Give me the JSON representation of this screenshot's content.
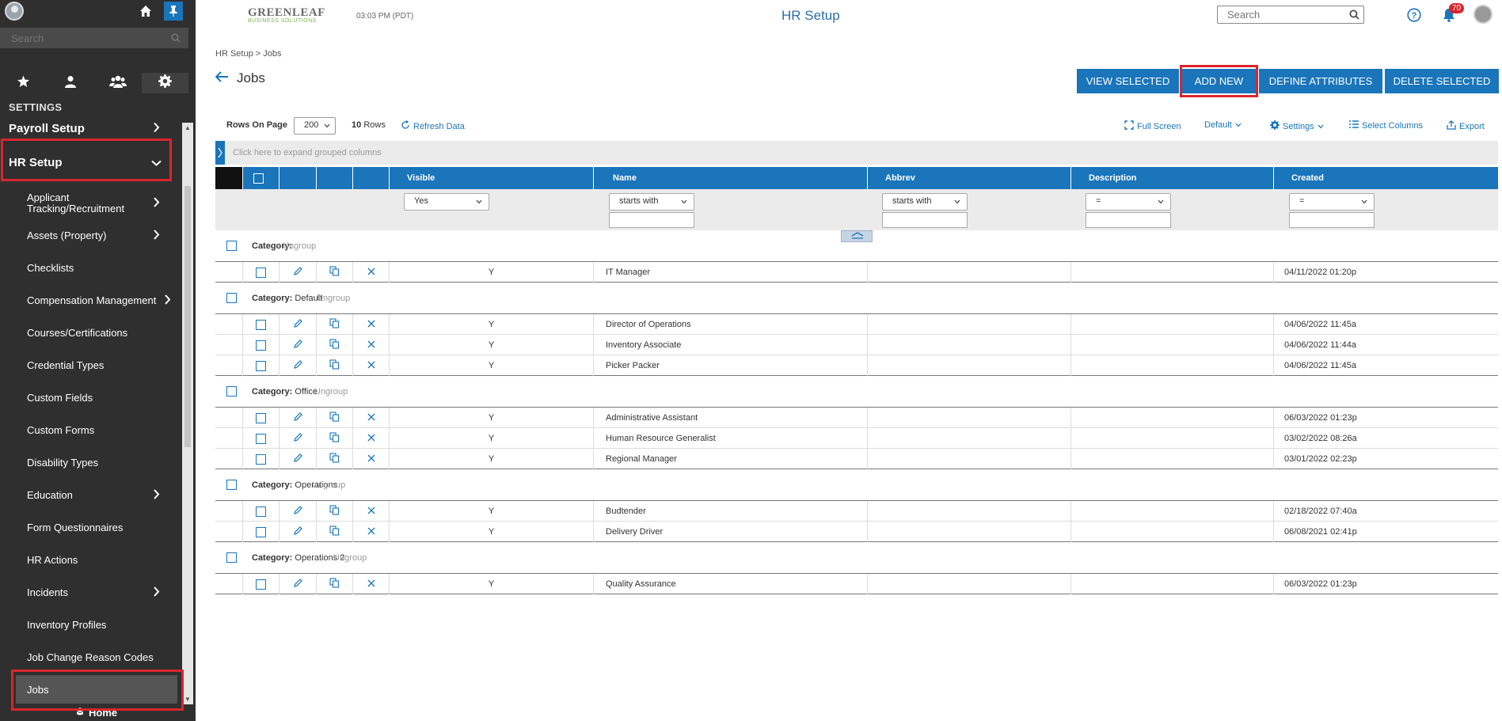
{
  "sidebar": {
    "search_placeholder": "Search",
    "settings_label": "SETTINGS",
    "items": [
      {
        "label": "Payroll Setup",
        "level": 1
      },
      {
        "label": "HR Setup",
        "level": 1
      },
      {
        "label": "Applicant Tracking/Recruitment",
        "level": 2
      },
      {
        "label": "Assets (Property)",
        "level": 2
      },
      {
        "label": "Checklists",
        "level": 2
      },
      {
        "label": "Compensation Management",
        "level": 2
      },
      {
        "label": "Courses/Certifications",
        "level": 2
      },
      {
        "label": "Credential Types",
        "level": 2
      },
      {
        "label": "Custom Fields",
        "level": 2
      },
      {
        "label": "Custom Forms",
        "level": 2
      },
      {
        "label": "Disability Types",
        "level": 2
      },
      {
        "label": "Education",
        "level": 2
      },
      {
        "label": "Form Questionnaires",
        "level": 2
      },
      {
        "label": "HR Actions",
        "level": 2
      },
      {
        "label": "Incidents",
        "level": 2
      },
      {
        "label": "Inventory Profiles",
        "level": 2
      },
      {
        "label": "Job Change Reason Codes",
        "level": 2
      },
      {
        "label": "Jobs",
        "level": 2
      }
    ],
    "bottom_home": "Home"
  },
  "header": {
    "logo_line1": "GREENLEAF",
    "logo_line2": "BUSINESS SOLUTIONS",
    "time": "03:03 PM (PDT)",
    "title": "HR Setup",
    "search_placeholder": "Search",
    "notification_count": "70"
  },
  "breadcrumb": "HR Setup  >  Jobs",
  "page_title": "Jobs",
  "actions": {
    "view_selected": "VIEW SELECTED",
    "add_new": "ADD NEW",
    "define_attributes": "DEFINE ATTRIBUTES",
    "delete_selected": "DELETE SELECTED"
  },
  "toolbar": {
    "rows_on_page_label": "Rows On Page",
    "rows_on_page_value": "200",
    "rows_count": "10",
    "rows_label": "Rows",
    "refresh": "Refresh Data",
    "full_screen": "Full Screen",
    "default_view": "Default",
    "settings": "Settings",
    "select_columns": "Select Columns",
    "export": "Export"
  },
  "group_bar_text": "Click here to expand grouped columns",
  "columns": [
    "Visible",
    "Name",
    "Abbrev",
    "Description",
    "Created"
  ],
  "filters": {
    "visible": "Yes",
    "name": "starts with",
    "abbrev": "starts with",
    "description": "=",
    "created": "="
  },
  "category_label": "Category:",
  "ungroup_label": "Ungroup",
  "groups": [
    {
      "category": "",
      "rows": [
        {
          "visible": "Y",
          "name": "IT Manager",
          "created": "04/11/2022 01:20p"
        }
      ]
    },
    {
      "category": "Default",
      "rows": [
        {
          "visible": "Y",
          "name": "Director of Operations",
          "created": "04/06/2022 11:45a"
        },
        {
          "visible": "Y",
          "name": "Inventory Associate",
          "created": "04/06/2022 11:44a"
        },
        {
          "visible": "Y",
          "name": "Picker Packer",
          "created": "04/06/2022 11:45a"
        }
      ]
    },
    {
      "category": "Office",
      "rows": [
        {
          "visible": "Y",
          "name": "Administrative Assistant",
          "created": "06/03/2022 01:23p"
        },
        {
          "visible": "Y",
          "name": "Human Resource Generalist",
          "created": "03/02/2022 08:26a"
        },
        {
          "visible": "Y",
          "name": "Regional Manager",
          "created": "03/01/2022 02:23p"
        }
      ]
    },
    {
      "category": "Operations",
      "rows": [
        {
          "visible": "Y",
          "name": "Budtender",
          "created": "02/18/2022 07:40a"
        },
        {
          "visible": "Y",
          "name": "Delivery Driver",
          "created": "06/08/2021 02:41p"
        }
      ]
    },
    {
      "category": "Operations 2",
      "rows": [
        {
          "visible": "Y",
          "name": "Quality Assurance",
          "created": "06/03/2022 01:23p"
        }
      ]
    }
  ],
  "colors": {
    "accent": "#1a75bb",
    "sidebar": "#2f2f2f",
    "highlight": "#d9252d"
  }
}
